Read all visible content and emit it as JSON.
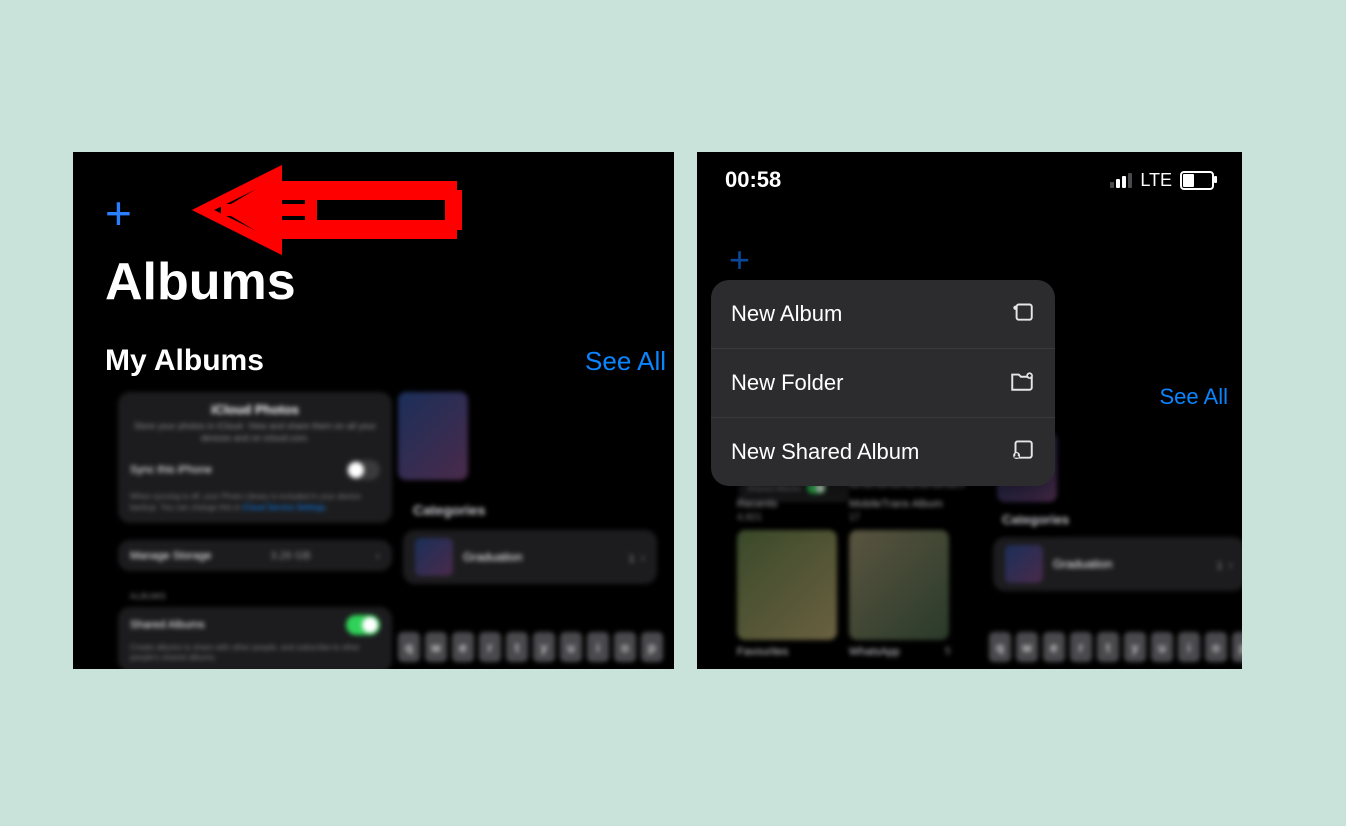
{
  "colors": {
    "accent": "#0a84ff",
    "annotate": "#ff0000",
    "bg": "#c9e2da"
  },
  "left": {
    "title": "Albums",
    "section": "My Albums",
    "see_all": "See All",
    "icloud": {
      "heading": "iCloud Photos",
      "desc": "Store your photos in iCloud. View and share them on all your devices and on icloud.com.",
      "sync_label": "Sync this iPhone",
      "sync_on": false,
      "note_prefix": "When syncing is off, your Photo Library is included in your device backup. You can change this in ",
      "note_link": "iCloud Service Settings",
      "manage_label": "Manage Storage",
      "manage_value": "3.26 GB",
      "albums_header": "ALBUMS",
      "shared_label": "Shared Albums",
      "shared_on": true,
      "shared_note": "Create albums to share with other people, and subscribe to other people's shared albums."
    },
    "categories_label": "Categories",
    "category": {
      "name": "Graduation",
      "count": "1"
    },
    "keys": [
      "q",
      "w",
      "e",
      "r",
      "t",
      "y",
      "u",
      "i",
      "o",
      "p"
    ]
  },
  "right": {
    "time": "00:58",
    "net": "LTE",
    "see_all": "See All",
    "menu": [
      {
        "label": "New Album",
        "icon": "album"
      },
      {
        "label": "New Folder",
        "icon": "folder"
      },
      {
        "label": "New Shared Album",
        "icon": "shared"
      }
    ],
    "tiles": [
      {
        "name": "Recents",
        "count": "4,921"
      },
      {
        "name": "MobileTrans Album",
        "count": "17"
      },
      {
        "name": "Favourites",
        "count": ""
      },
      {
        "name": "WhatsApp",
        "count": "5"
      }
    ],
    "categories_label": "Categories",
    "category": {
      "name": "Graduation",
      "count": "1"
    },
    "keys": [
      "q",
      "w",
      "e",
      "r",
      "t",
      "y",
      "u",
      "i",
      "o",
      "p"
    ]
  }
}
